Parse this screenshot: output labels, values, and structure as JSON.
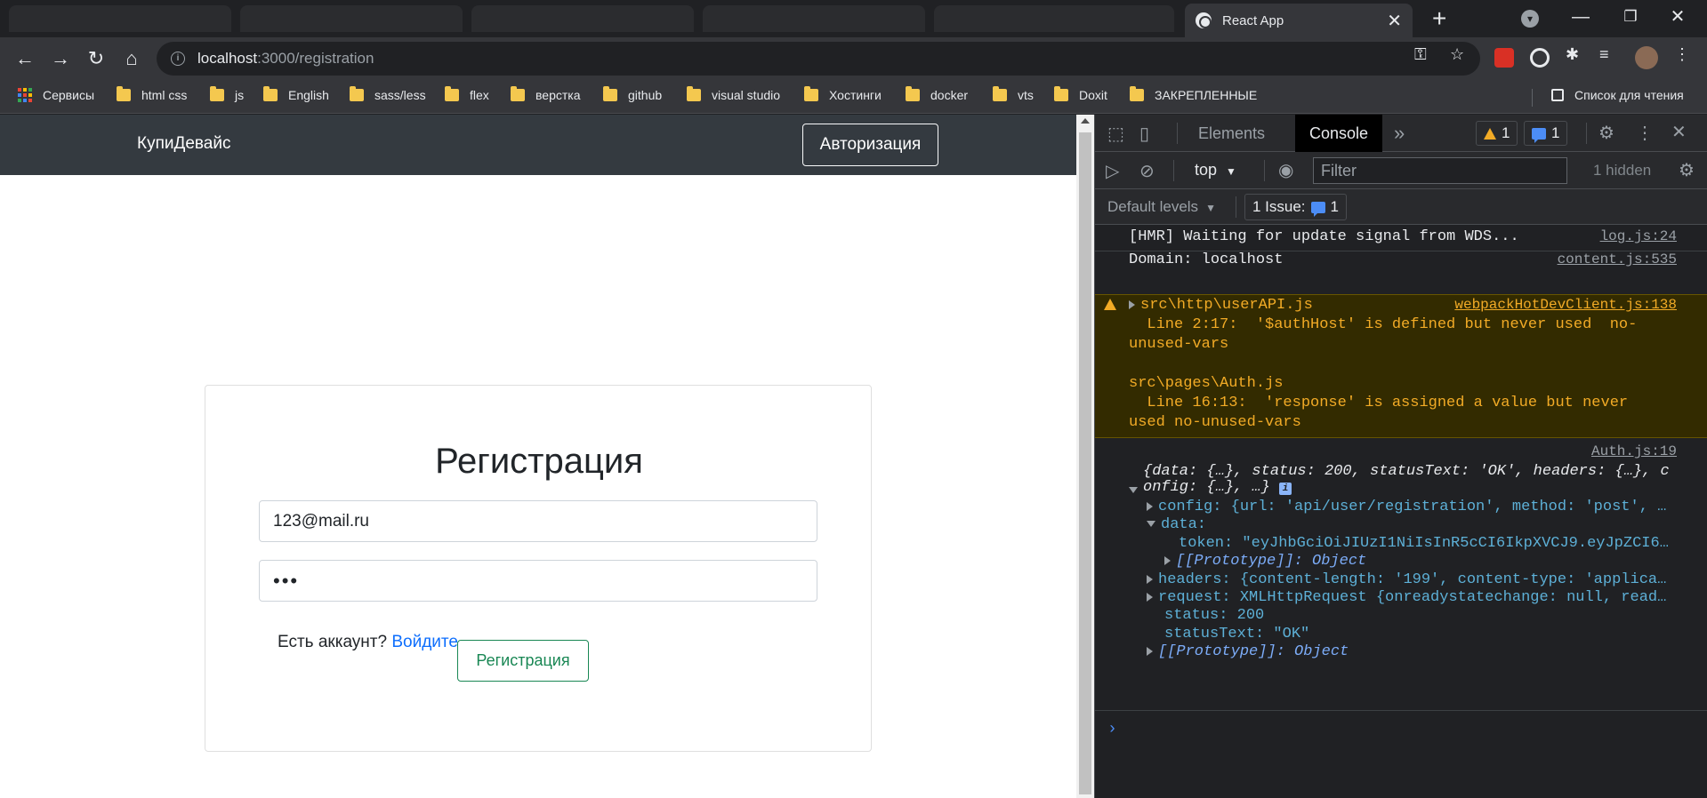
{
  "browser": {
    "tab_title": "React App",
    "url_host": "localhost",
    "url_path": ":3000/registration",
    "bookmarks": [
      "Сервисы",
      "html css",
      "js",
      "English",
      "sass/less",
      "flex",
      "верстка",
      "github",
      "visual studio",
      "Хостинги",
      "docker",
      "vts",
      "Doxit",
      "ЗАКРЕПЛЕННЫЕ"
    ],
    "reading_list": "Список для чтения"
  },
  "page": {
    "brand": "КупиДевайс",
    "auth_button": "Авторизация",
    "form": {
      "title": "Регистрация",
      "email_value": "123@mail.ru",
      "password_mask": "•••",
      "have_account": "Есть аккаунт? ",
      "login_link": "Войдите",
      "submit_label": "Регистрация"
    }
  },
  "devtools": {
    "tabs": [
      "Elements",
      "Console"
    ],
    "warning_count": "1",
    "message_count": "1",
    "context": "top",
    "filter_placeholder": "Filter",
    "hidden": "1 hidden",
    "levels": "Default levels",
    "issues_label": "1 Issue:",
    "issues_count": "1",
    "log": {
      "hmr": "[HMR] Waiting for update signal from WDS...",
      "hmr_src": "log.js:24",
      "domain": "Domain: localhost",
      "domain_src": "content.js:535",
      "warn_file1": "src\\http\\userAPI.js",
      "warn_src": "webpackHotDevClient.js:138",
      "warn_line1a": "  Line 2:17:  '$authHost' is defined but never used  no-",
      "warn_line1b": "unused-vars",
      "warn_file2": "src\\pages\\Auth.js",
      "warn_line2a": "  Line 16:13:  'response' is assigned a value but never",
      "warn_line2b": "used  no-unused-vars",
      "auth_src": "Auth.js:19",
      "obj_summary_a": "{data: {…}, status: 200, statusText: 'OK', headers: {…}, c",
      "obj_summary_b": "onfig: {…}, …}",
      "config": "config: {url: 'api/user/registration', method: 'post', …",
      "data": "data:",
      "token": "token: \"eyJhbGciOiJIUzI1NiIsInR5cCI6IkpXVCJ9.eyJpZCI6…",
      "proto1": "[[Prototype]]: Object",
      "headers": "headers: {content-length: '199', content-type: 'applica…",
      "request": "request: XMLHttpRequest {onreadystatechange: null, read…",
      "status": "status: 200",
      "status_text": "statusText: \"OK\"",
      "proto2": "[[Prototype]]: Object"
    }
  },
  "colors": {
    "navbar": "#343a40",
    "link": "#0d6efd",
    "success": "#198754",
    "devtools_bg": "#202124",
    "warning": "#f2ab26"
  }
}
